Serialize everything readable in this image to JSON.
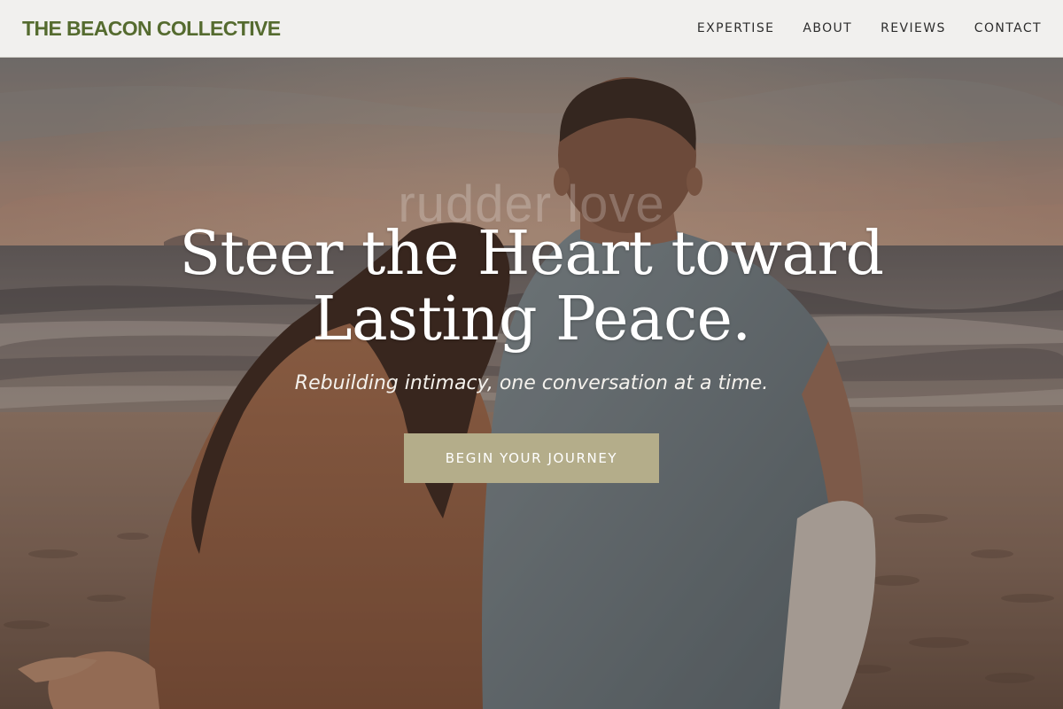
{
  "header": {
    "brand": "THE BEACON COLLECTIVE",
    "nav": [
      {
        "label": "EXPERTISE"
      },
      {
        "label": "ABOUT"
      },
      {
        "label": "REVIEWS"
      },
      {
        "label": "CONTACT"
      }
    ]
  },
  "hero": {
    "title_line1": "Steer the Heart toward",
    "title_line2": "Lasting Peace.",
    "watermark": "rudder love",
    "subtitle": "Rebuilding intimacy, one conversation at a time.",
    "cta_label": "BEGIN YOUR JOURNEY",
    "background_image": "couple-sitting-on-beach-at-sunset"
  },
  "colors": {
    "brand": "#556b2f",
    "header_bg": "#f1f0ee",
    "cta_bg": "#b4ad8a",
    "hero_text": "#ffffff"
  }
}
